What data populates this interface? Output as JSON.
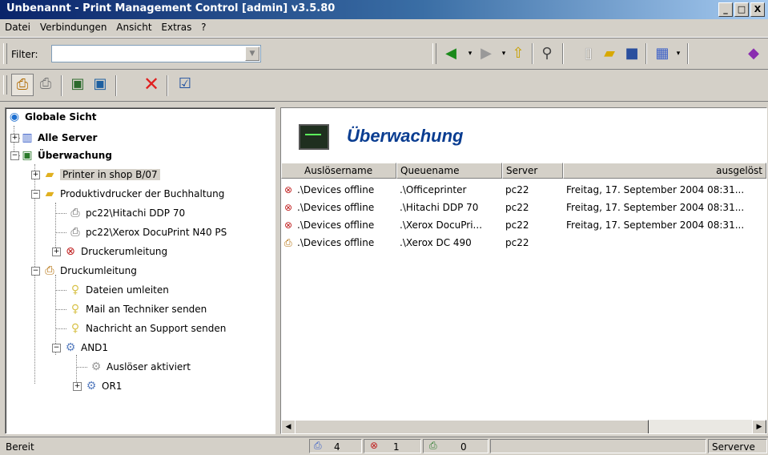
{
  "window": {
    "title": "Unbenannt - Print Management Control [admin]  v3.5.80",
    "buttons": [
      "_",
      "□",
      "X"
    ]
  },
  "menu": [
    "Datei",
    "Verbindungen",
    "Ansicht",
    "Extras",
    "?"
  ],
  "toolbar": {
    "filter_label": "Filter:",
    "filter_value": "",
    "icons": [
      "back-icon",
      "forward-icon",
      "up-folder-icon",
      "search-icon",
      "new-document-icon",
      "open-folder-icon",
      "save-icon",
      "view-icon",
      "book-icon"
    ]
  },
  "toolbar2": {
    "icons": [
      "printer-connect-icon",
      "printer-icon",
      "server-icon",
      "server-add-icon",
      "delete-icon",
      "properties-icon"
    ]
  },
  "tree": {
    "root": "Globale Sicht",
    "items": [
      {
        "label": "Alle Server",
        "bold": true
      },
      {
        "label": "Überwachung",
        "bold": true
      },
      {
        "label": "Printer in shop B/07"
      },
      {
        "label": "Produktivdrucker der Buchhaltung"
      },
      {
        "label": "pc22\\Hitachi DDP 70"
      },
      {
        "label": "pc22\\Xerox DocuPrint N40 PS"
      },
      {
        "label": "Druckerumleitung"
      },
      {
        "label": "Druckumleitung"
      },
      {
        "label": "Dateien umleiten"
      },
      {
        "label": "Mail an Techniker senden"
      },
      {
        "label": "Nachricht an Support senden"
      },
      {
        "label": "AND1"
      },
      {
        "label": "Auslöser aktiviert"
      },
      {
        "label": "OR1"
      }
    ]
  },
  "panel": {
    "title": "Überwachung",
    "columns": [
      "Auslösername",
      "Queuename",
      "Server",
      "ausgelöst"
    ],
    "rows": [
      {
        "name": ".\\Devices offline",
        "queue": ".\\Officeprinter",
        "server": "pc22",
        "triggered": "Freitag, 17. September 2004  08:31..."
      },
      {
        "name": ".\\Devices offline",
        "queue": ".\\Hitachi DDP 70",
        "server": "pc22",
        "triggered": "Freitag, 17. September 2004  08:31..."
      },
      {
        "name": ".\\Devices offline",
        "queue": ".\\Xerox DocuPri...",
        "server": "pc22",
        "triggered": "Freitag, 17. September 2004  08:31..."
      },
      {
        "name": ".\\Devices offline",
        "queue": ".\\Xerox DC 490",
        "server": "pc22",
        "triggered": ""
      }
    ]
  },
  "status": {
    "text": "Bereit",
    "count1": "4",
    "count2": "1",
    "count3": "0",
    "right": "Serverve"
  }
}
